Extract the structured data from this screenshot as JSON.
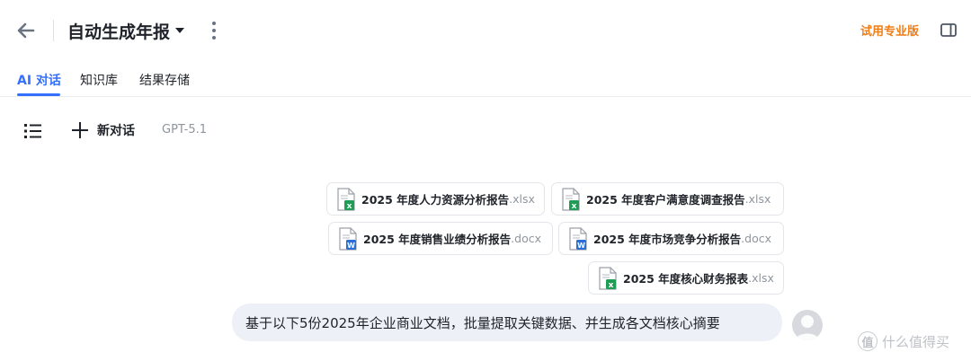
{
  "header": {
    "title": "自动生成年报",
    "upgrade_label": "试用专业版"
  },
  "tabs": [
    {
      "label": "AI 对话",
      "active": true
    },
    {
      "label": "知识库",
      "active": false
    },
    {
      "label": "结果存储",
      "active": false
    }
  ],
  "toolbar": {
    "new_chat_label": "新对话",
    "model": "GPT-5.1"
  },
  "attachments": [
    {
      "name": "2025 年度人力资源分析报告",
      "ext": ".xlsx",
      "type": "excel"
    },
    {
      "name": "2025 年度客户满意度调查报告",
      "ext": ".xlsx",
      "type": "excel"
    },
    {
      "name": "2025 年度销售业绩分析报告",
      "ext": ".docx",
      "type": "word"
    },
    {
      "name": "2025 年度市场竞争分析报告",
      "ext": ".docx",
      "type": "word"
    },
    {
      "name": "2025 年度核心财务报表",
      "ext": ".xlsx",
      "type": "excel"
    }
  ],
  "message": {
    "text": "基于以下5份2025年企业商业文档，批量提取关键数据、并生成各文档核心摘要"
  },
  "watermark": {
    "badge": "值",
    "text": "什么值得买"
  },
  "colors": {
    "accent": "#3370ff",
    "upgrade": "#f07d16",
    "excel": "#1f9d55",
    "word": "#2b6fd6",
    "bubble": "#eef0f8"
  },
  "icons": [
    "back-arrow-icon",
    "caret-down-icon",
    "more-vertical-icon",
    "sidebar-panel-icon",
    "list-icon",
    "plus-icon",
    "excel-file-icon",
    "word-file-icon",
    "user-avatar-icon"
  ]
}
